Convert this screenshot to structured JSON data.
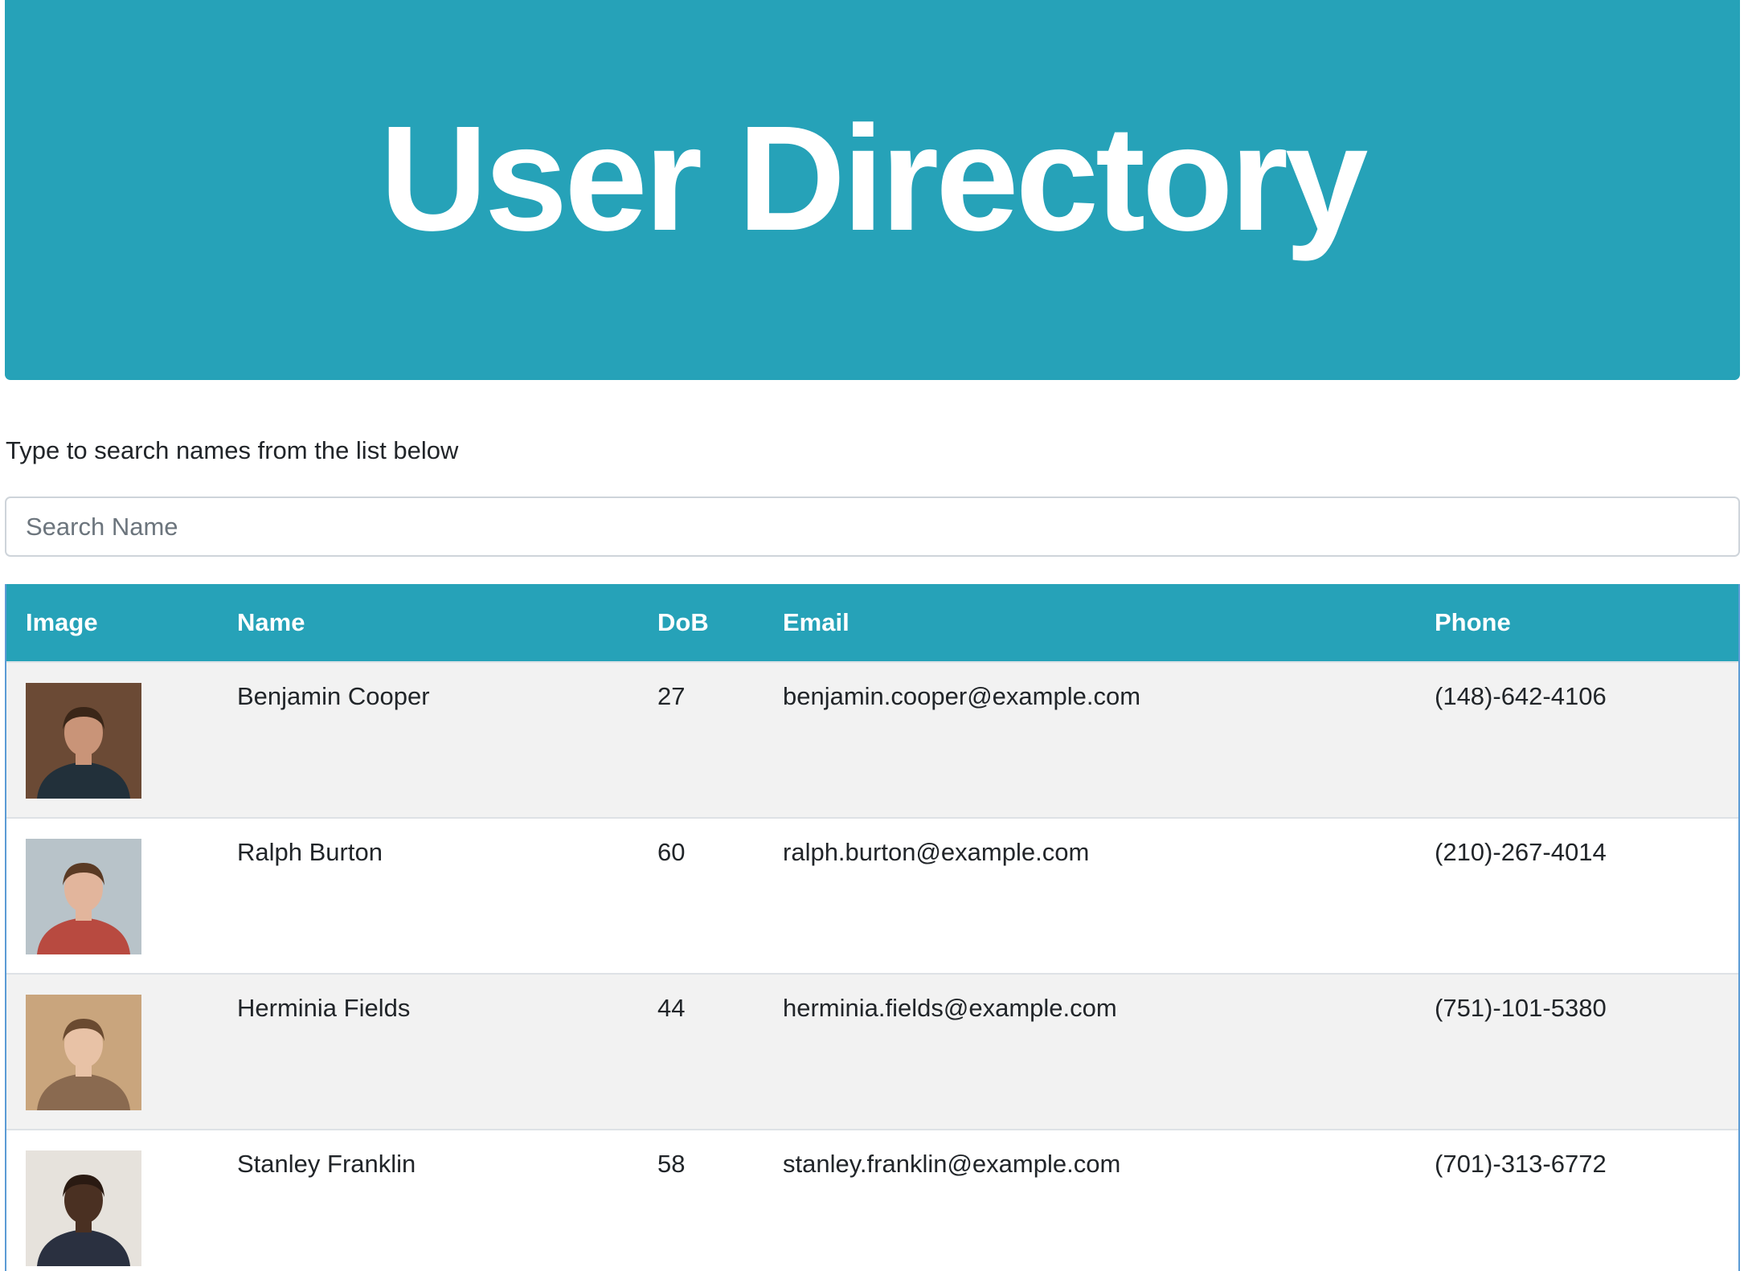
{
  "header": {
    "title": "User Directory"
  },
  "search": {
    "instructions": "Type to search names from the list below",
    "placeholder": "Search Name",
    "value": ""
  },
  "table": {
    "columns": [
      "Image",
      "Name",
      "DoB",
      "Email",
      "Phone"
    ],
    "rows": [
      {
        "name": "Benjamin Cooper",
        "dob": "27",
        "email": "benjamin.cooper@example.com",
        "phone": "(148)-642-4106",
        "avatar_colors": {
          "bg": "#6b4a35",
          "skin": "#c99478",
          "hair": "#3a2618",
          "shirt": "#22303a"
        }
      },
      {
        "name": "Ralph Burton",
        "dob": "60",
        "email": "ralph.burton@example.com",
        "phone": "(210)-267-4014",
        "avatar_colors": {
          "bg": "#b8c3c9",
          "skin": "#e2b59c",
          "hair": "#5a3a24",
          "shirt": "#b84a40"
        }
      },
      {
        "name": "Herminia Fields",
        "dob": "44",
        "email": "herminia.fields@example.com",
        "phone": "(751)-101-5380",
        "avatar_colors": {
          "bg": "#c9a57d",
          "skin": "#e8c2a6",
          "hair": "#6a4a30",
          "shirt": "#8a6a50"
        }
      },
      {
        "name": "Stanley Franklin",
        "dob": "58",
        "email": "stanley.franklin@example.com",
        "phone": "(701)-313-6772",
        "avatar_colors": {
          "bg": "#e6e2dc",
          "skin": "#4a3022",
          "hair": "#2a1a12",
          "shirt": "#2a3040"
        }
      }
    ]
  },
  "colors": {
    "accent": "#26a2b8",
    "row_stripe": "#f2f2f2",
    "border": "#dee2e6"
  }
}
